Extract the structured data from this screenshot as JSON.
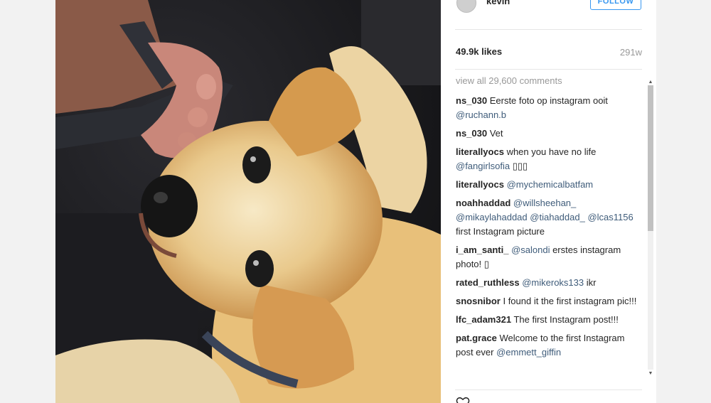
{
  "header": {
    "username": "kevin",
    "follow_label": "FOLLOW"
  },
  "post": {
    "likes": "49.9k likes",
    "age": "291w",
    "view_all": "view all 29,600 comments"
  },
  "comments": [
    {
      "user": "ns_030",
      "parts": [
        {
          "t": "Eerste foto op instagram ooit "
        },
        {
          "m": "@ruchann.b"
        }
      ]
    },
    {
      "user": "ns_030",
      "parts": [
        {
          "t": "Vet"
        }
      ]
    },
    {
      "user": "literallyocs",
      "parts": [
        {
          "t": "when you have no life "
        },
        {
          "m": "@fangirlsofia"
        },
        {
          "t": " ▯▯▯"
        }
      ]
    },
    {
      "user": "literallyocs",
      "parts": [
        {
          "m": "@mychemicalbatfam"
        }
      ]
    },
    {
      "user": "noahhaddad",
      "parts": [
        {
          "m": "@willsheehan_"
        },
        {
          "t": " "
        },
        {
          "m": "@mikaylahaddad"
        },
        {
          "t": " "
        },
        {
          "m": "@tiahaddad_"
        },
        {
          "t": " "
        },
        {
          "m": "@lcas1156"
        },
        {
          "t": " first Instagram picture"
        }
      ]
    },
    {
      "user": "i_am_santi_",
      "parts": [
        {
          "m": "@salondi"
        },
        {
          "t": " erstes instagram photo! ▯"
        }
      ]
    },
    {
      "user": "rated_ruthless",
      "parts": [
        {
          "m": "@mikeroks133"
        },
        {
          "t": " ikr"
        }
      ]
    },
    {
      "user": "snosnibor",
      "parts": [
        {
          "t": "I found it the first instagram pic!!!"
        }
      ]
    },
    {
      "user": "lfc_adam321",
      "parts": [
        {
          "t": "The first Instagram post!!!"
        }
      ]
    },
    {
      "user": "pat.grace",
      "parts": [
        {
          "t": "Welcome to the first Instagram post ever "
        },
        {
          "m": "@emmett_giffin"
        }
      ]
    }
  ],
  "icons": {
    "like": "heart-icon",
    "scroll_up": "scroll-up-arrow",
    "scroll_down": "scroll-down-arrow"
  },
  "colors": {
    "accent": "#3897f0",
    "mention": "#3f5c7a",
    "muted": "#999999"
  }
}
